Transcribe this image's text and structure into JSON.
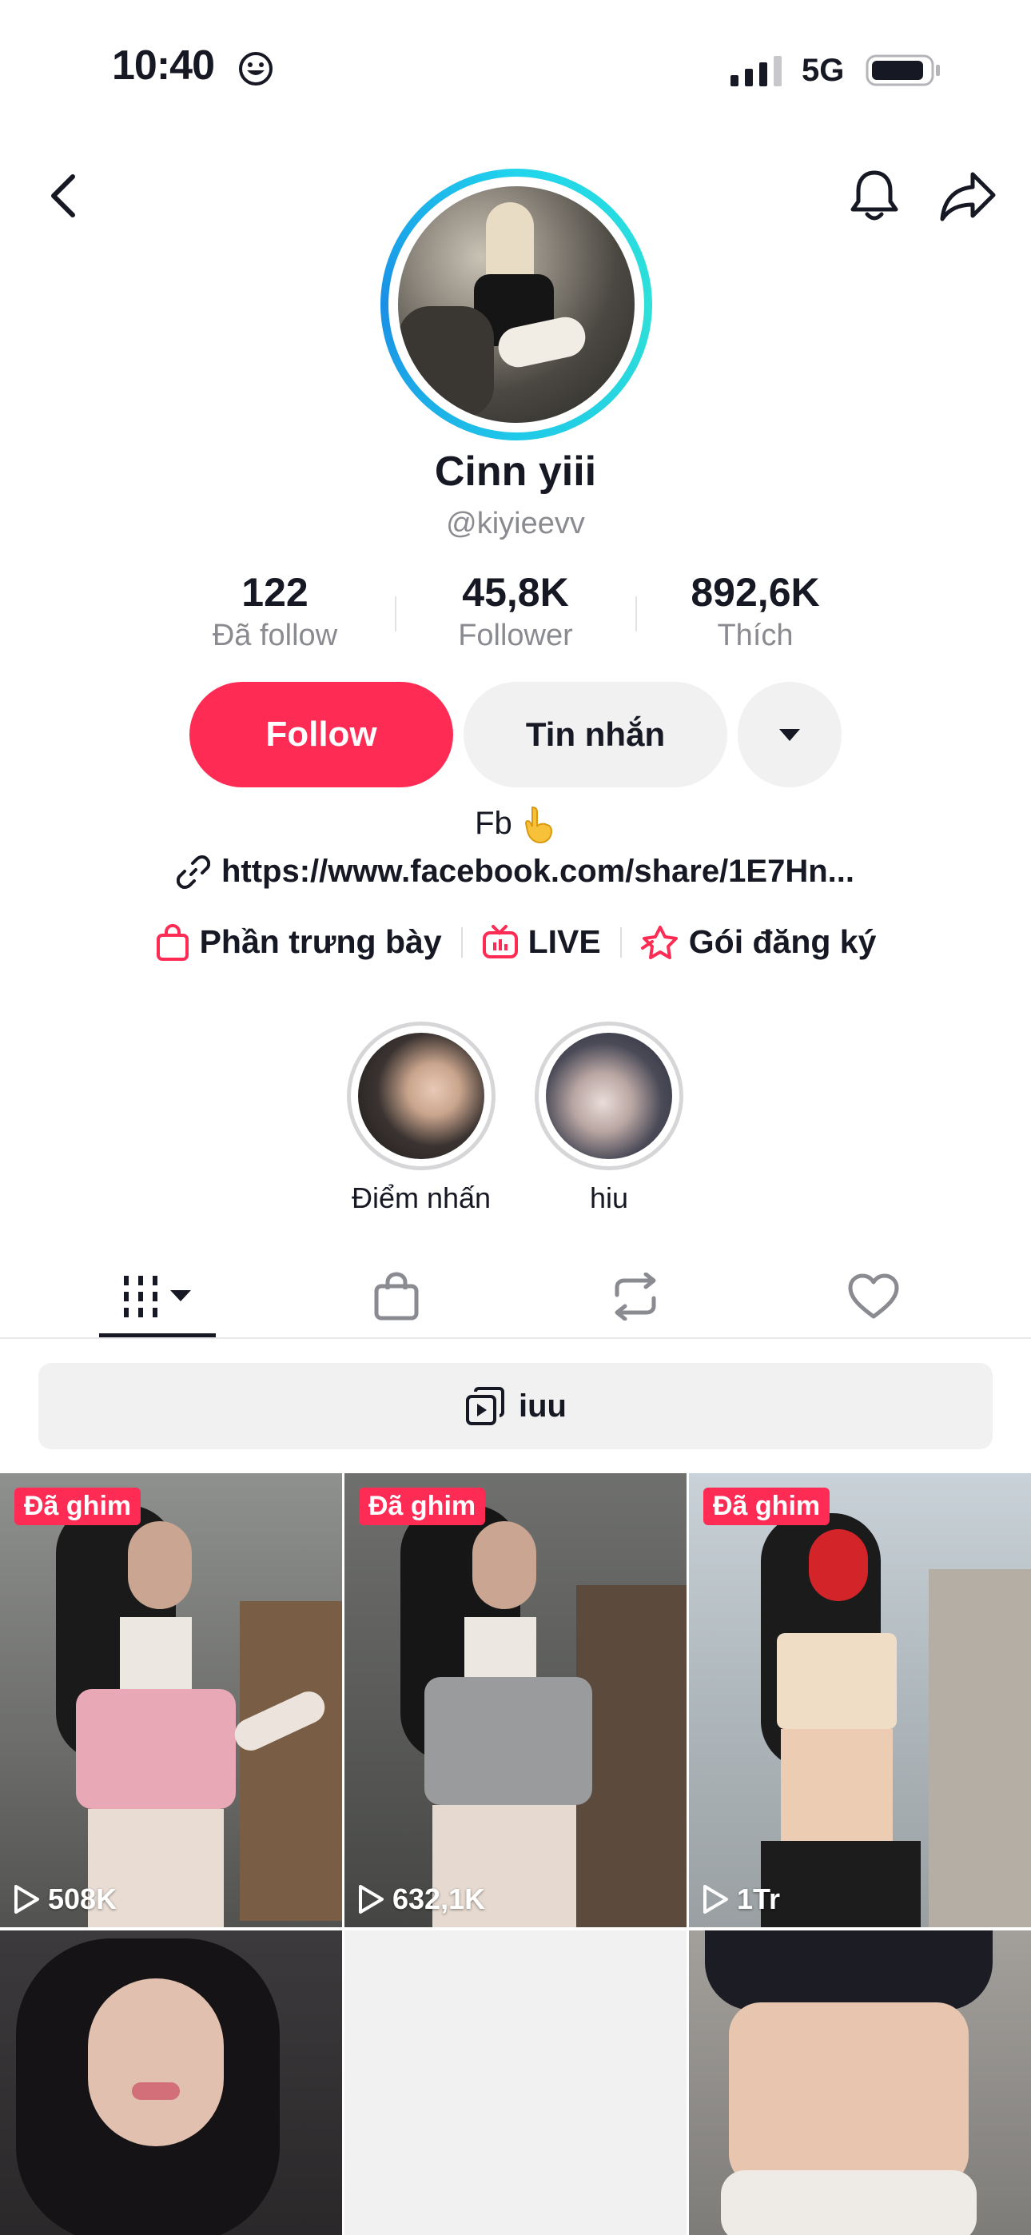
{
  "status_bar": {
    "time": "10:40",
    "network": "5G"
  },
  "profile": {
    "display_name": "Cinn yiii",
    "username": "@kiyieevv",
    "bio": "Fb",
    "link": "https://www.facebook.com/share/1E7Hn..."
  },
  "stats": [
    {
      "value": "122",
      "label": "Đã follow"
    },
    {
      "value": "45,8K",
      "label": "Follower"
    },
    {
      "value": "892,6K",
      "label": "Thích"
    }
  ],
  "actions": {
    "follow": "Follow",
    "message": "Tin nhắn"
  },
  "shortcuts": [
    {
      "label": "Phần trưng bày",
      "icon": "shopping-bag-icon"
    },
    {
      "label": "LIVE",
      "icon": "live-tv-icon"
    },
    {
      "label": "Gói đăng ký",
      "icon": "subscription-star-icon"
    }
  ],
  "highlights": [
    {
      "label": "Điểm nhấn"
    },
    {
      "label": "hiu"
    }
  ],
  "tabs": [
    {
      "name": "videos",
      "icon": "grid-icon",
      "active": true
    },
    {
      "name": "shop",
      "icon": "shopping-bag-icon"
    },
    {
      "name": "reposts",
      "icon": "repost-icon"
    },
    {
      "name": "liked",
      "icon": "heart-icon"
    }
  ],
  "playlist": {
    "label": "iuu"
  },
  "videos": [
    {
      "pinned_label": "Đã ghim",
      "views": "508K"
    },
    {
      "pinned_label": "Đã ghim",
      "views": "632,1K"
    },
    {
      "pinned_label": "Đã ghim",
      "views": "1Tr"
    },
    {
      "pinned_label": "",
      "views": ""
    },
    {
      "pinned_label": "",
      "views": ""
    },
    {
      "pinned_label": "",
      "views": ""
    }
  ],
  "colors": {
    "accent": "#fe2c55",
    "ring": "#20d5ec",
    "muted": "#8a8b91"
  }
}
